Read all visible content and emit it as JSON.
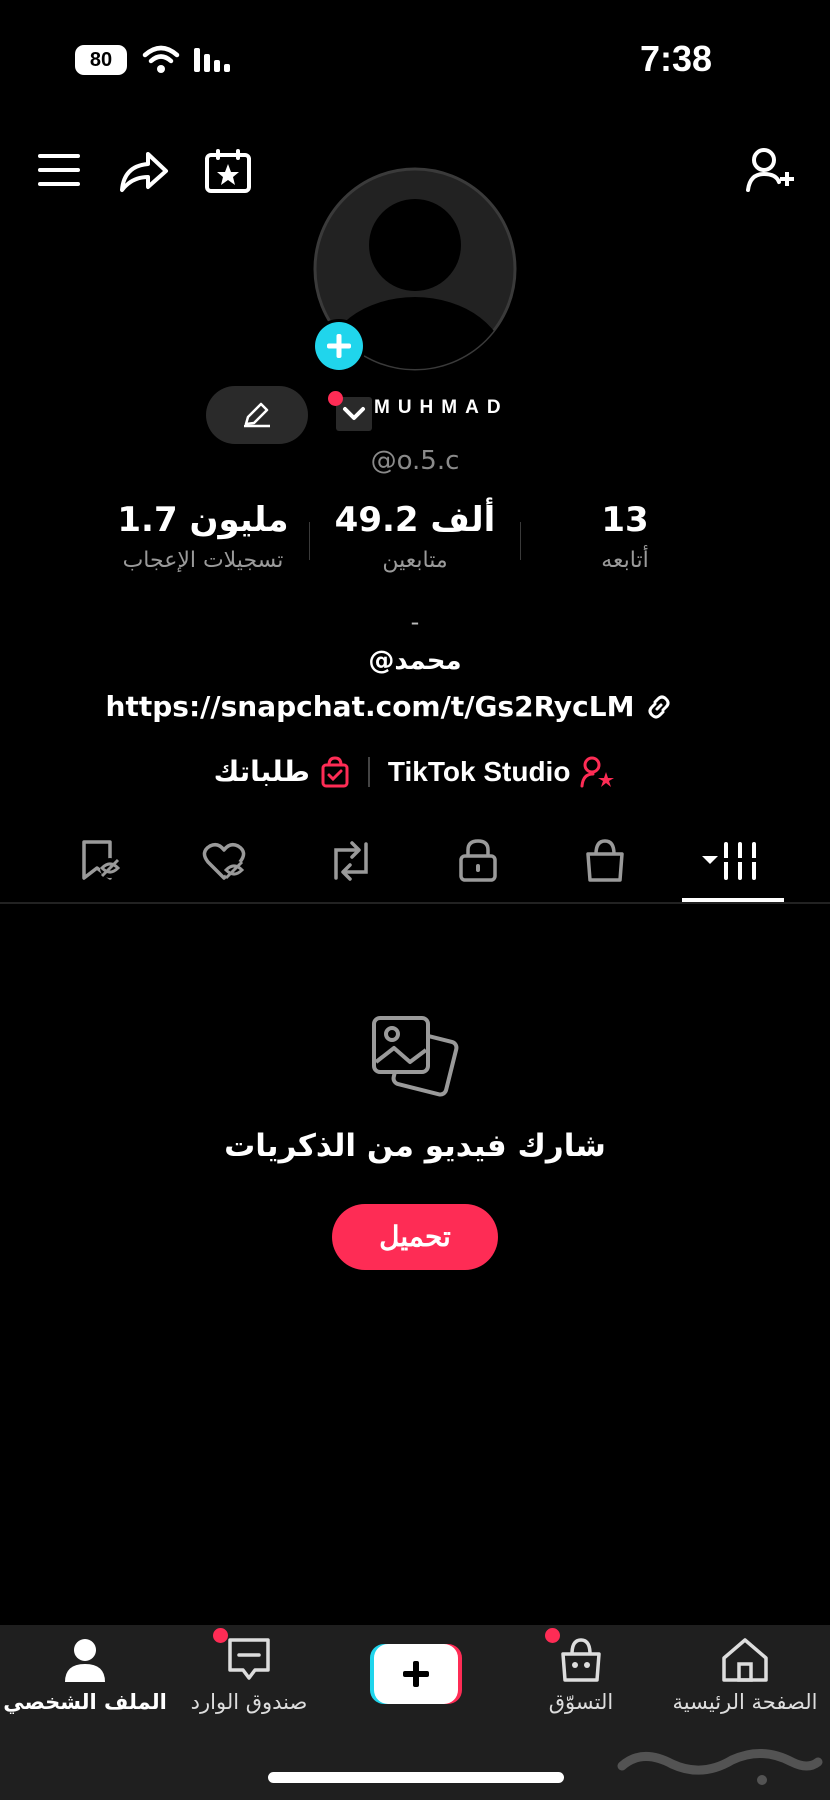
{
  "status_bar": {
    "time": "7:38",
    "battery": "80"
  },
  "profile": {
    "username": "MUHMAD",
    "handle": "@o.5.c",
    "bio_line1": "-",
    "bio_line2": "@محمد",
    "link": "https://snapchat.com/t/Gs2RycLM"
  },
  "stats": [
    {
      "value": "13",
      "label": "أتابعه"
    },
    {
      "value": "49.2 ألف",
      "label": "متابعين"
    },
    {
      "value": "1.7 مليون",
      "label": "تسجيلات الإعجاب"
    }
  ],
  "shortcuts": {
    "studio": "TikTok Studio",
    "orders": "طلباتك"
  },
  "empty_state": {
    "title": "شارك فيديو من الذكريات",
    "button": "تحميل"
  },
  "bottom_nav": {
    "home": "الصفحة الرئيسية",
    "shop": "التسوّق",
    "inbox": "صندوق الوارد",
    "profile": "الملف الشخصي"
  },
  "colors": {
    "accent": "#fe2c55",
    "add_badge": "#20d5ec",
    "background": "#000000"
  },
  "icons": [
    "menu-icon",
    "share-icon",
    "calendar-star-icon",
    "add-user-icon",
    "pencil-icon",
    "link-icon",
    "bag-icon",
    "videos-grid-icon",
    "shop-bag-icon",
    "lock-icon",
    "repost-icon",
    "liked-hidden-icon",
    "favorites-hidden-icon",
    "photos-icon",
    "home-icon",
    "plus-icon",
    "inbox-icon",
    "profile-icon"
  ]
}
